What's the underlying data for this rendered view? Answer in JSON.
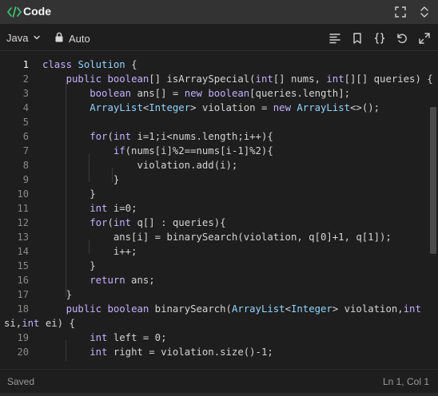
{
  "app": {
    "title": "Code",
    "title_icon": "code-brackets-icon",
    "window_controls": [
      "fullscreen-icon",
      "collapse-icon"
    ]
  },
  "toolbar": {
    "language": "Java",
    "auto_label": "Auto",
    "icons": [
      "format-align-icon",
      "bookmark-icon",
      "braces-icon",
      "undo-icon",
      "expand-icon"
    ]
  },
  "editor": {
    "active_line": 1,
    "lines": [
      {
        "num": "1",
        "text": "class Solution {"
      },
      {
        "num": "2",
        "text": "    public boolean[] isArraySpecial(int[] nums, int[][] queries) {"
      },
      {
        "num": "3",
        "text": "        boolean ans[] = new boolean[queries.length];"
      },
      {
        "num": "4",
        "text": "        ArrayList<Integer> violation = new ArrayList<>();"
      },
      {
        "num": "5",
        "text": ""
      },
      {
        "num": "6",
        "text": "        for(int i=1;i<nums.length;i++){"
      },
      {
        "num": "7",
        "text": "            if(nums[i]%2==nums[i-1]%2){"
      },
      {
        "num": "8",
        "text": "                violation.add(i);"
      },
      {
        "num": "9",
        "text": "            }"
      },
      {
        "num": "10",
        "text": "        }"
      },
      {
        "num": "11",
        "text": "        int i=0;"
      },
      {
        "num": "12",
        "text": "        for(int q[] : queries){"
      },
      {
        "num": "13",
        "text": "            ans[i] = binarySearch(violation, q[0]+1, q[1]);"
      },
      {
        "num": "14",
        "text": "            i++;"
      },
      {
        "num": "15",
        "text": "        }"
      },
      {
        "num": "16",
        "text": "        return ans;"
      },
      {
        "num": "17",
        "text": "    }"
      },
      {
        "num": "18",
        "text": "    public boolean binarySearch(ArrayList<Integer> violation,int"
      },
      {
        "num": "",
        "text": "si,int ei) {"
      },
      {
        "num": "19",
        "text": "        int left = 0;"
      },
      {
        "num": "20",
        "text": "        int right = violation.size()-1;"
      }
    ]
  },
  "status": {
    "saved": "Saved",
    "cursor": "Ln 1, Col 1"
  },
  "colors": {
    "background": "#1e1e1e",
    "titlebar": "#333333",
    "keyword": "#c4b0ff",
    "type": "#8fd5ff",
    "text": "#d4d4d4",
    "accent_green": "#3fbf6f"
  }
}
